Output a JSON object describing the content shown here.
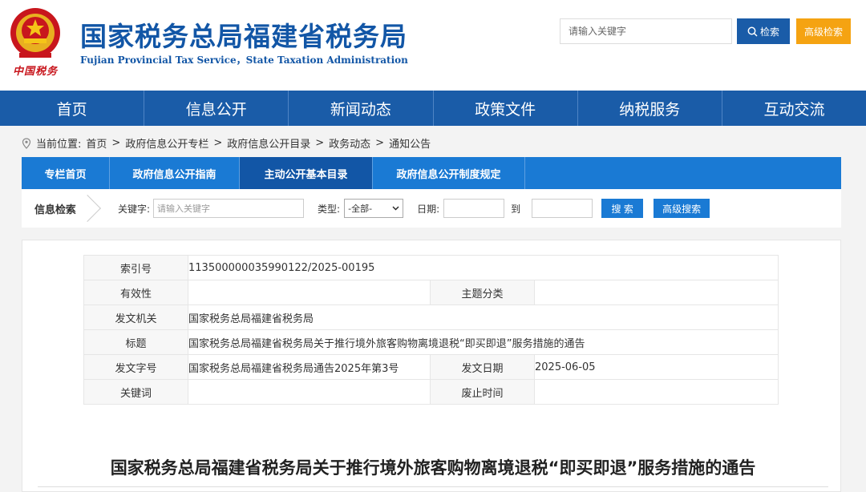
{
  "header": {
    "title": "国家税务总局福建省税务局",
    "subtitle": "Fujian Provincial Tax Service，State Taxation Administration",
    "logo_text": "中国税务",
    "search_placeholder": "请输入关键字",
    "search_button": "检索",
    "advanced_button": "高级检索"
  },
  "nav": {
    "items": [
      "首页",
      "信息公开",
      "新闻动态",
      "政策文件",
      "纳税服务",
      "互动交流"
    ]
  },
  "breadcrumb": {
    "prefix": "当前位置:",
    "items": [
      "首页",
      "政府信息公开专栏",
      "政府信息公开目录",
      "政务动态",
      "通知公告"
    ],
    "separator": ">"
  },
  "subnav": {
    "items": [
      "专栏首页",
      "政府信息公开指南",
      "主动公开基本目录",
      "政府信息公开制度规定"
    ],
    "active_index": 2
  },
  "filter": {
    "title": "信息检索",
    "keyword_label": "关键字:",
    "keyword_placeholder": "请输入关键字",
    "type_label": "类型:",
    "type_value": "-全部-",
    "date_label": "日期:",
    "to_label": "到",
    "search_button": "搜 索",
    "advanced_button": "高级搜索"
  },
  "meta": {
    "index_label": "索引号",
    "index_value": "113500000035990122/2025-00195",
    "validity_label": "有效性",
    "validity_value": "",
    "topic_label": "主题分类",
    "topic_value": "",
    "issuer_label": "发文机关",
    "issuer_value": "国家税务总局福建省税务局",
    "title_label": "标题",
    "title_value": "国家税务总局福建省税务局关于推行境外旅客购物离境退税“即买即退”服务措施的通告",
    "docno_label": "发文字号",
    "docno_value": "国家税务总局福建省税务局通告2025年第3号",
    "date_label": "发文日期",
    "date_value": "2025-06-05",
    "keywords_label": "关键词",
    "keywords_value": "",
    "expiry_label": "废止时间",
    "expiry_value": ""
  },
  "article": {
    "title": "国家税务总局福建省税务局关于推行境外旅客购物离境退税“即买即退”服务措施的通告"
  },
  "colors": {
    "primary_blue": "#1a5ca8",
    "subnav_blue": "#1a7ad4",
    "orange": "#f5a312",
    "emblem_red": "#c8161d"
  }
}
